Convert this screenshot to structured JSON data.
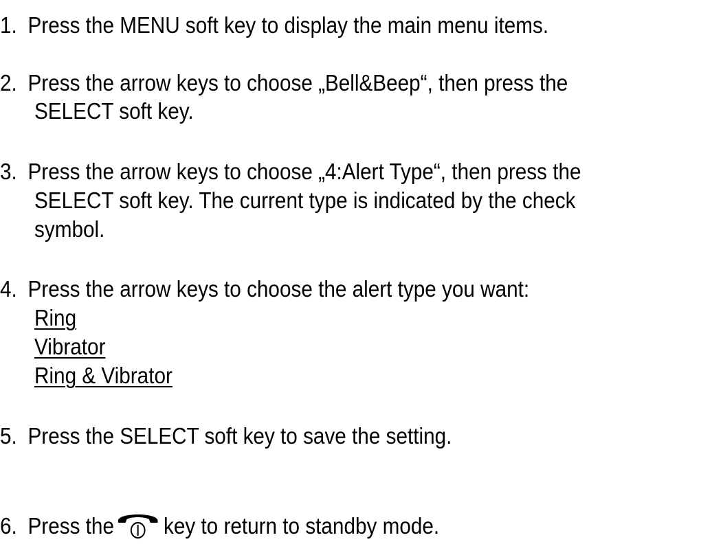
{
  "steps": [
    {
      "number": "1.",
      "lines": [
        "Press the MENU soft key to display the main menu items."
      ]
    },
    {
      "number": "2.",
      "lines": [
        "Press the arrow keys to choose „Bell&Beep“, then press the",
        "SELECT soft key."
      ]
    },
    {
      "number": "3.",
      "lines": [
        "Press the arrow keys to choose „4:Alert Type“, then press the",
        "SELECT soft key. The current type is indicated by the check",
        "symbol."
      ]
    },
    {
      "number": "4.",
      "lines": [
        "Press the arrow keys to choose the alert type you want:"
      ],
      "options": [
        "Ring",
        "Vibrator",
        "Ring & Vibrator"
      ]
    },
    {
      "number": "5.",
      "lines": [
        "Press the SELECT soft key to save the setting."
      ]
    },
    {
      "number": "6.",
      "before_icon": "Press the",
      "icon": "phone-end-key-icon",
      "after_icon": "key to return to standby mode."
    }
  ]
}
